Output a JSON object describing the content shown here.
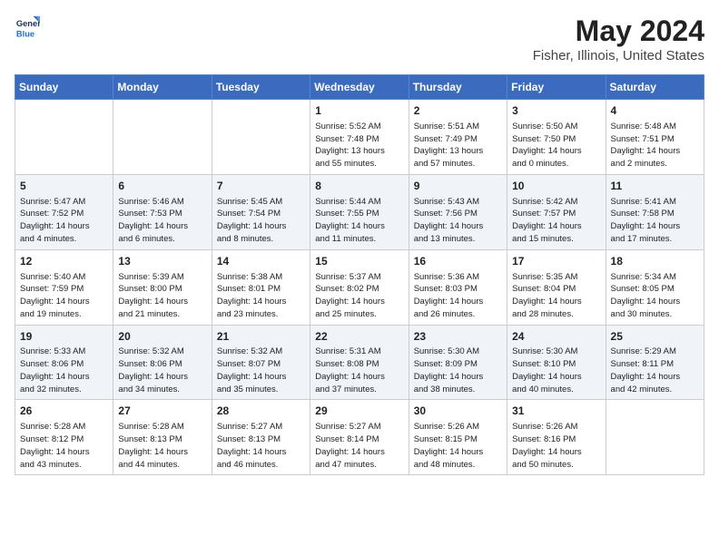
{
  "header": {
    "logo_line1": "General",
    "logo_line2": "Blue",
    "title": "May 2024",
    "subtitle": "Fisher, Illinois, United States"
  },
  "days_of_week": [
    "Sunday",
    "Monday",
    "Tuesday",
    "Wednesday",
    "Thursday",
    "Friday",
    "Saturday"
  ],
  "weeks": [
    [
      {
        "day": "",
        "info": ""
      },
      {
        "day": "",
        "info": ""
      },
      {
        "day": "",
        "info": ""
      },
      {
        "day": "1",
        "info": "Sunrise: 5:52 AM\nSunset: 7:48 PM\nDaylight: 13 hours\nand 55 minutes."
      },
      {
        "day": "2",
        "info": "Sunrise: 5:51 AM\nSunset: 7:49 PM\nDaylight: 13 hours\nand 57 minutes."
      },
      {
        "day": "3",
        "info": "Sunrise: 5:50 AM\nSunset: 7:50 PM\nDaylight: 14 hours\nand 0 minutes."
      },
      {
        "day": "4",
        "info": "Sunrise: 5:48 AM\nSunset: 7:51 PM\nDaylight: 14 hours\nand 2 minutes."
      }
    ],
    [
      {
        "day": "5",
        "info": "Sunrise: 5:47 AM\nSunset: 7:52 PM\nDaylight: 14 hours\nand 4 minutes."
      },
      {
        "day": "6",
        "info": "Sunrise: 5:46 AM\nSunset: 7:53 PM\nDaylight: 14 hours\nand 6 minutes."
      },
      {
        "day": "7",
        "info": "Sunrise: 5:45 AM\nSunset: 7:54 PM\nDaylight: 14 hours\nand 8 minutes."
      },
      {
        "day": "8",
        "info": "Sunrise: 5:44 AM\nSunset: 7:55 PM\nDaylight: 14 hours\nand 11 minutes."
      },
      {
        "day": "9",
        "info": "Sunrise: 5:43 AM\nSunset: 7:56 PM\nDaylight: 14 hours\nand 13 minutes."
      },
      {
        "day": "10",
        "info": "Sunrise: 5:42 AM\nSunset: 7:57 PM\nDaylight: 14 hours\nand 15 minutes."
      },
      {
        "day": "11",
        "info": "Sunrise: 5:41 AM\nSunset: 7:58 PM\nDaylight: 14 hours\nand 17 minutes."
      }
    ],
    [
      {
        "day": "12",
        "info": "Sunrise: 5:40 AM\nSunset: 7:59 PM\nDaylight: 14 hours\nand 19 minutes."
      },
      {
        "day": "13",
        "info": "Sunrise: 5:39 AM\nSunset: 8:00 PM\nDaylight: 14 hours\nand 21 minutes."
      },
      {
        "day": "14",
        "info": "Sunrise: 5:38 AM\nSunset: 8:01 PM\nDaylight: 14 hours\nand 23 minutes."
      },
      {
        "day": "15",
        "info": "Sunrise: 5:37 AM\nSunset: 8:02 PM\nDaylight: 14 hours\nand 25 minutes."
      },
      {
        "day": "16",
        "info": "Sunrise: 5:36 AM\nSunset: 8:03 PM\nDaylight: 14 hours\nand 26 minutes."
      },
      {
        "day": "17",
        "info": "Sunrise: 5:35 AM\nSunset: 8:04 PM\nDaylight: 14 hours\nand 28 minutes."
      },
      {
        "day": "18",
        "info": "Sunrise: 5:34 AM\nSunset: 8:05 PM\nDaylight: 14 hours\nand 30 minutes."
      }
    ],
    [
      {
        "day": "19",
        "info": "Sunrise: 5:33 AM\nSunset: 8:06 PM\nDaylight: 14 hours\nand 32 minutes."
      },
      {
        "day": "20",
        "info": "Sunrise: 5:32 AM\nSunset: 8:06 PM\nDaylight: 14 hours\nand 34 minutes."
      },
      {
        "day": "21",
        "info": "Sunrise: 5:32 AM\nSunset: 8:07 PM\nDaylight: 14 hours\nand 35 minutes."
      },
      {
        "day": "22",
        "info": "Sunrise: 5:31 AM\nSunset: 8:08 PM\nDaylight: 14 hours\nand 37 minutes."
      },
      {
        "day": "23",
        "info": "Sunrise: 5:30 AM\nSunset: 8:09 PM\nDaylight: 14 hours\nand 38 minutes."
      },
      {
        "day": "24",
        "info": "Sunrise: 5:30 AM\nSunset: 8:10 PM\nDaylight: 14 hours\nand 40 minutes."
      },
      {
        "day": "25",
        "info": "Sunrise: 5:29 AM\nSunset: 8:11 PM\nDaylight: 14 hours\nand 42 minutes."
      }
    ],
    [
      {
        "day": "26",
        "info": "Sunrise: 5:28 AM\nSunset: 8:12 PM\nDaylight: 14 hours\nand 43 minutes."
      },
      {
        "day": "27",
        "info": "Sunrise: 5:28 AM\nSunset: 8:13 PM\nDaylight: 14 hours\nand 44 minutes."
      },
      {
        "day": "28",
        "info": "Sunrise: 5:27 AM\nSunset: 8:13 PM\nDaylight: 14 hours\nand 46 minutes."
      },
      {
        "day": "29",
        "info": "Sunrise: 5:27 AM\nSunset: 8:14 PM\nDaylight: 14 hours\nand 47 minutes."
      },
      {
        "day": "30",
        "info": "Sunrise: 5:26 AM\nSunset: 8:15 PM\nDaylight: 14 hours\nand 48 minutes."
      },
      {
        "day": "31",
        "info": "Sunrise: 5:26 AM\nSunset: 8:16 PM\nDaylight: 14 hours\nand 50 minutes."
      },
      {
        "day": "",
        "info": ""
      }
    ]
  ]
}
